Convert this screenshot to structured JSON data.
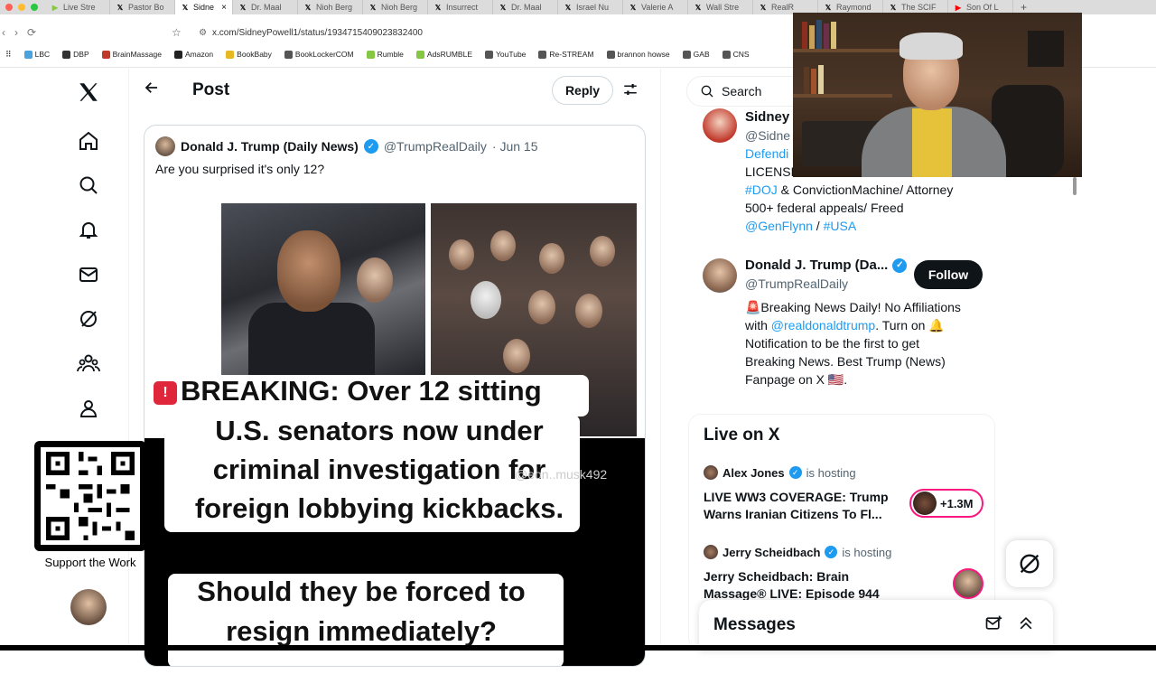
{
  "browser": {
    "tabs": [
      {
        "label": "Live Stre",
        "icon": "rumble-icon",
        "color": "#85c742"
      },
      {
        "label": "Pastor Bo",
        "icon": "x-icon",
        "color": "#000000"
      },
      {
        "label": "Sidne",
        "icon": "x-icon",
        "color": "#000000",
        "active": true
      },
      {
        "label": "Dr. Maal",
        "icon": "x-icon",
        "color": "#000000"
      },
      {
        "label": "Nioh Berg",
        "icon": "x-icon",
        "color": "#000000"
      },
      {
        "label": "Nioh Berg",
        "icon": "x-icon",
        "color": "#000000"
      },
      {
        "label": "Insurrect",
        "icon": "x-icon",
        "color": "#000000"
      },
      {
        "label": "Dr. Maal",
        "icon": "x-icon",
        "color": "#000000"
      },
      {
        "label": "Israel Nu",
        "icon": "x-icon",
        "color": "#000000"
      },
      {
        "label": "Valerie A",
        "icon": "x-icon",
        "color": "#000000"
      },
      {
        "label": "Wall Stre",
        "icon": "x-icon",
        "color": "#000000"
      },
      {
        "label": "RealR",
        "icon": "x-icon",
        "color": "#000000"
      },
      {
        "label": "Raymond",
        "icon": "x-icon",
        "color": "#000000"
      },
      {
        "label": "The SCIF",
        "icon": "x-icon",
        "color": "#000000"
      },
      {
        "label": "Son Of L",
        "icon": "youtube-icon",
        "color": "#ff0000"
      }
    ],
    "tab_close": "×",
    "new_tab": "+",
    "url": "x.com/SidneyPowell1/status/1934715409023832400",
    "bookmarks": [
      {
        "label": "LBC",
        "color": "#4aa3df"
      },
      {
        "label": "DBP",
        "color": "#333333"
      },
      {
        "label": "BrainMassage",
        "color": "#c0392b"
      },
      {
        "label": "Amazon",
        "color": "#222222"
      },
      {
        "label": "BookBaby",
        "color": "#e8b820"
      },
      {
        "label": "BookLockerCOM",
        "color": "#555555"
      },
      {
        "label": "Rumble",
        "color": "#85c742"
      },
      {
        "label": "AdsRUMBLE",
        "color": "#85c742"
      },
      {
        "label": "YouTube",
        "color": "#555555"
      },
      {
        "label": "Re-STREAM",
        "color": "#555555"
      },
      {
        "label": "brannon howse",
        "color": "#555555"
      },
      {
        "label": "GAB",
        "color": "#555555"
      },
      {
        "label": "CNS",
        "color": "#555555"
      }
    ]
  },
  "header": {
    "title": "Post",
    "reply_label": "Reply"
  },
  "quote": {
    "author_name": "Donald J. Trump (Daily News)",
    "author_handle": "@TrumpRealDaily",
    "date": "· Jun 15",
    "text": "Are you surprised it's only 12?",
    "caption_lines": [
      "BREAKING: Over 12 sitting",
      "U.S. senators now under",
      "criminal investigation for",
      "foreign lobbying kickbacks."
    ],
    "question_lines": [
      "Should they be forced to",
      "resign immediately?"
    ],
    "watermark": "@eon..musk492"
  },
  "sidebar": {
    "search_placeholder": "Search",
    "profile_partial": {
      "name": "Sidney",
      "handle": "@Sidne",
      "bio_line1": "Defendi",
      "bio_line2": "LICENSE",
      "bio_line3_parts": [
        {
          "text": "#DOJ",
          "link": true
        },
        {
          "text": " & ConvictionMachine/ Attorney",
          "link": false
        }
      ],
      "bio_line4": "500+ federal appeals/ Freed",
      "bio_line5_parts": [
        {
          "text": "@GenFlynn",
          "link": true
        },
        {
          "text": " / ",
          "link": false
        },
        {
          "text": "#USA",
          "link": true
        }
      ]
    },
    "who_to_follow": {
      "name": "Donald J. Trump (Da...",
      "handle": "@TrumpRealDaily",
      "follow_label": "Follow",
      "bio": [
        {
          "text": "🚨Breaking News Daily! No Affiliations",
          "link": false
        },
        {
          "text": "with ",
          "link": false
        },
        {
          "text": "@realdonaldtrump",
          "link": true
        },
        {
          "text": ". Turn on 🔔",
          "link": false
        },
        {
          "text": "Notification to be the first to get",
          "link": false
        },
        {
          "text": "Breaking News. Best Trump (News)",
          "link": false
        },
        {
          "text": "Fanpage on X 🇺🇸.",
          "link": false
        }
      ]
    },
    "live": {
      "title": "Live on X",
      "items": [
        {
          "host": "Alex Jones",
          "status": "is hosting",
          "title": "LIVE WW3 COVERAGE: Trump Warns Iranian Citizens To Fl...",
          "listeners": "+1.3M"
        },
        {
          "host": "Jerry Scheidbach",
          "status": "is hosting",
          "title": "Jerry Scheidbach: Brain Massage® LIVE: Episode 944",
          "listeners": ""
        }
      ]
    },
    "messages_label": "Messages"
  },
  "overlay": {
    "support_label": "Support the Work"
  },
  "colors": {
    "accent": "#1d9bf0",
    "text": "#0f1419",
    "muted": "#536471",
    "live_ring": "#f91880"
  }
}
